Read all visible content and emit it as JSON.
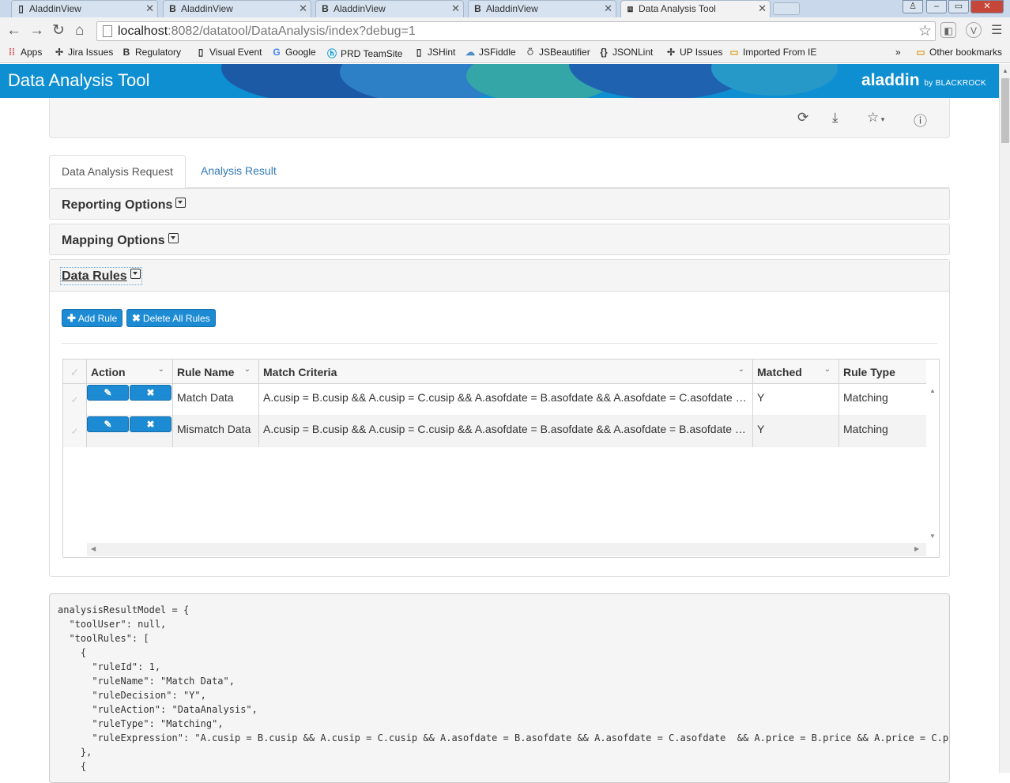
{
  "browser": {
    "tabs": [
      {
        "title": "AladdinView",
        "icon": "page-icon"
      },
      {
        "title": "AladdinView",
        "icon": "b-icon"
      },
      {
        "title": "AladdinView",
        "icon": "b-icon"
      },
      {
        "title": "AladdinView",
        "icon": "b-icon"
      },
      {
        "title": "Data Analysis Tool",
        "icon": "app-icon",
        "active": true
      }
    ],
    "url_host": "localhost",
    "url_path": ":8082/datatool/DataAnalysis/index?debug=1",
    "bookmarks": [
      "Apps",
      "Jira Issues",
      "Regulatory",
      "Visual Event",
      "Google",
      "PRD TeamSite",
      "JSHint",
      "JSFiddle",
      "JSBeautifier",
      "JSONLint",
      "UP Issues",
      "Imported From IE"
    ],
    "bookmarks_overflow": "»",
    "other_bookmarks": "Other bookmarks"
  },
  "app": {
    "title": "Data Analysis Tool",
    "brand": "aladdin",
    "brand_by": "by BLACKROCK"
  },
  "tabs": {
    "request": "Data Analysis Request",
    "result": "Analysis Result"
  },
  "sections": {
    "reporting": "Reporting Options",
    "mapping": "Mapping Options",
    "rules": "Data Rules"
  },
  "buttons": {
    "add_rule": "Add Rule",
    "delete_all": "Delete All Rules"
  },
  "grid": {
    "columns": [
      "Action",
      "Rule Name",
      "Match Criteria",
      "Matched",
      "Rule Type"
    ],
    "rows": [
      {
        "rule_name": "Match Data",
        "criteria": "A.cusip = B.cusip && A.cusip = C.cusip && A.asofdate = B.asofdate && A.asofdate = C.asofdate && A.price = B.price",
        "matched": "Y",
        "rule_type": "Matching"
      },
      {
        "rule_name": "Mismatch Data",
        "criteria": "A.cusip = B.cusip && A.cusip = C.cusip && A.asofdate = B.asofdate && A.asofdate = B.asofdate && A.price",
        "matched": "Y",
        "rule_type": "Matching"
      }
    ]
  },
  "debug_code": "analysisResultModel = {\n  \"toolUser\": null,\n  \"toolRules\": [\n    {\n      \"ruleId\": 1,\n      \"ruleName\": \"Match Data\",\n      \"ruleDecision\": \"Y\",\n      \"ruleAction\": \"DataAnalysis\",\n      \"ruleType\": \"Matching\",\n      \"ruleExpression\": \"A.cusip = B.cusip && A.cusip = C.cusip && A.asofdate = B.asofdate && A.asofdate = C.asofdate  && A.price = B.price && A.price = C.pri\n    },\n    {"
}
